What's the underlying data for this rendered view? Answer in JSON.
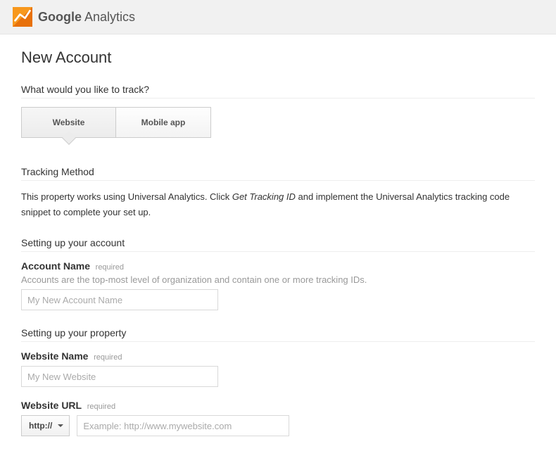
{
  "brand": {
    "bold": "Google",
    "light": " Analytics"
  },
  "page_title": "New Account",
  "track_heading": "What would you like to track?",
  "toggle": {
    "website": "Website",
    "mobile": "Mobile app"
  },
  "tracking_method": {
    "heading": "Tracking Method",
    "text_before": "This property works using Universal Analytics. Click ",
    "emph": "Get Tracking ID",
    "text_after": " and implement the Universal Analytics tracking code snippet to complete your set up."
  },
  "account": {
    "heading": "Setting up your account",
    "name_label": "Account Name",
    "required": "required",
    "hint": "Accounts are the top-most level of organization and contain one or more tracking IDs.",
    "placeholder": "My New Account Name"
  },
  "property": {
    "heading": "Setting up your property",
    "website_name_label": "Website Name",
    "required": "required",
    "website_name_placeholder": "My New Website",
    "url_label": "Website URL",
    "url_required": "required",
    "protocol": "http://",
    "url_placeholder": "Example: http://www.mywebsite.com"
  }
}
